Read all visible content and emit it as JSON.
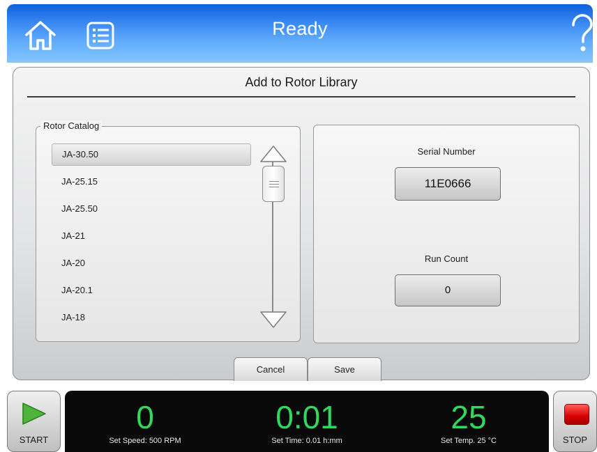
{
  "header": {
    "title": "Ready",
    "left_icons": [
      "home-icon",
      "list-icon"
    ],
    "right_icon": "help-icon",
    "gradient_top": "#0f5fdd",
    "gradient_bottom": "#85c7ff"
  },
  "dialog": {
    "title": "Add to Rotor Library",
    "catalog": {
      "legend": "Rotor Catalog",
      "items": [
        "JA-30.50",
        "JA-25.15",
        "JA-25.50",
        "JA-21",
        "JA-20",
        "JA-20.1",
        "JA-18"
      ],
      "selected": "JA-30.50"
    },
    "serial_number": {
      "label": "Serial Number",
      "value": "11E0666"
    },
    "run_count": {
      "label": "Run Count",
      "value": "0"
    },
    "buttons": {
      "cancel": "Cancel",
      "save": "Save"
    }
  },
  "status": {
    "start_label": "START",
    "stop_label": "STOP",
    "speed": {
      "value": "0",
      "set": "Set Speed: 500 RPM"
    },
    "time": {
      "value": "0:01",
      "set": "Set Time: 0.01 h:mm"
    },
    "temp": {
      "value": "25",
      "set": "Set Temp. 25 °C"
    },
    "value_color": "#2fd95f"
  }
}
